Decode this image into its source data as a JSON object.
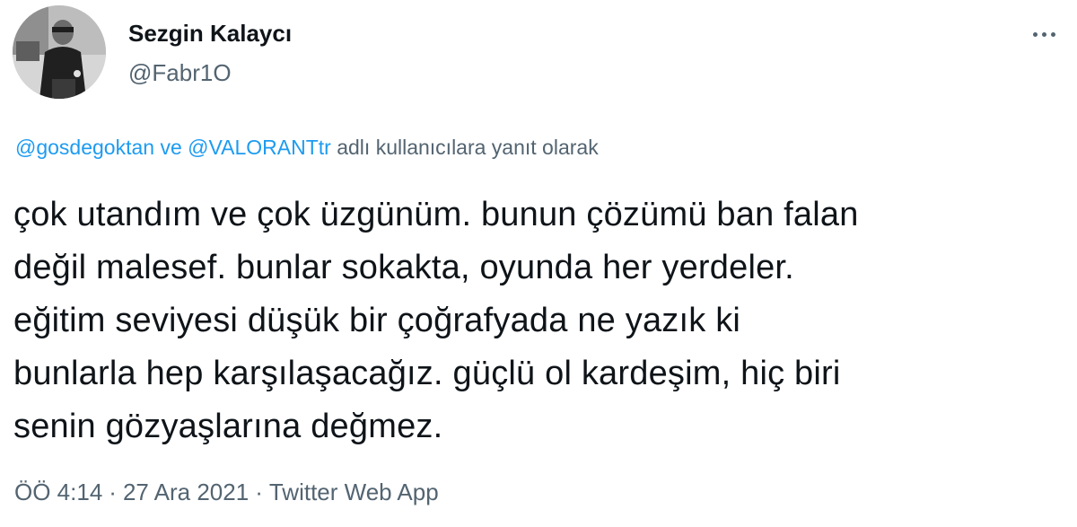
{
  "author": {
    "name": "Sezgin Kalaycı",
    "handle": "@Fabr1O"
  },
  "more_icon": "more-horizontal-icon",
  "reply_context": {
    "mention_1": "@gosdegoktan",
    "conjunction": " ve ",
    "mention_2": "@VALORANTtr",
    "suffix": " adlı kullanıcılara yanıt olarak"
  },
  "tweet": {
    "lines": [
      "çok utandım ve çok üzgünüm. bunun çözümü ban falan",
      "değil malesef. bunlar sokakta, oyunda her yerdeler.",
      "eğitim seviyesi düşük bir çoğrafyada ne yazık ki",
      "bunlarla hep karşılaşacağız. güçlü ol kardeşim, hiç biri",
      "senin gözyaşlarına değmez."
    ]
  },
  "meta": {
    "time": "ÖÖ 4:14",
    "separator": "·",
    "date": "27 Ara 2021",
    "source": "Twitter Web App"
  },
  "colors": {
    "text": "#0f1419",
    "secondary": "#536471",
    "link": "#1d9bf0"
  }
}
